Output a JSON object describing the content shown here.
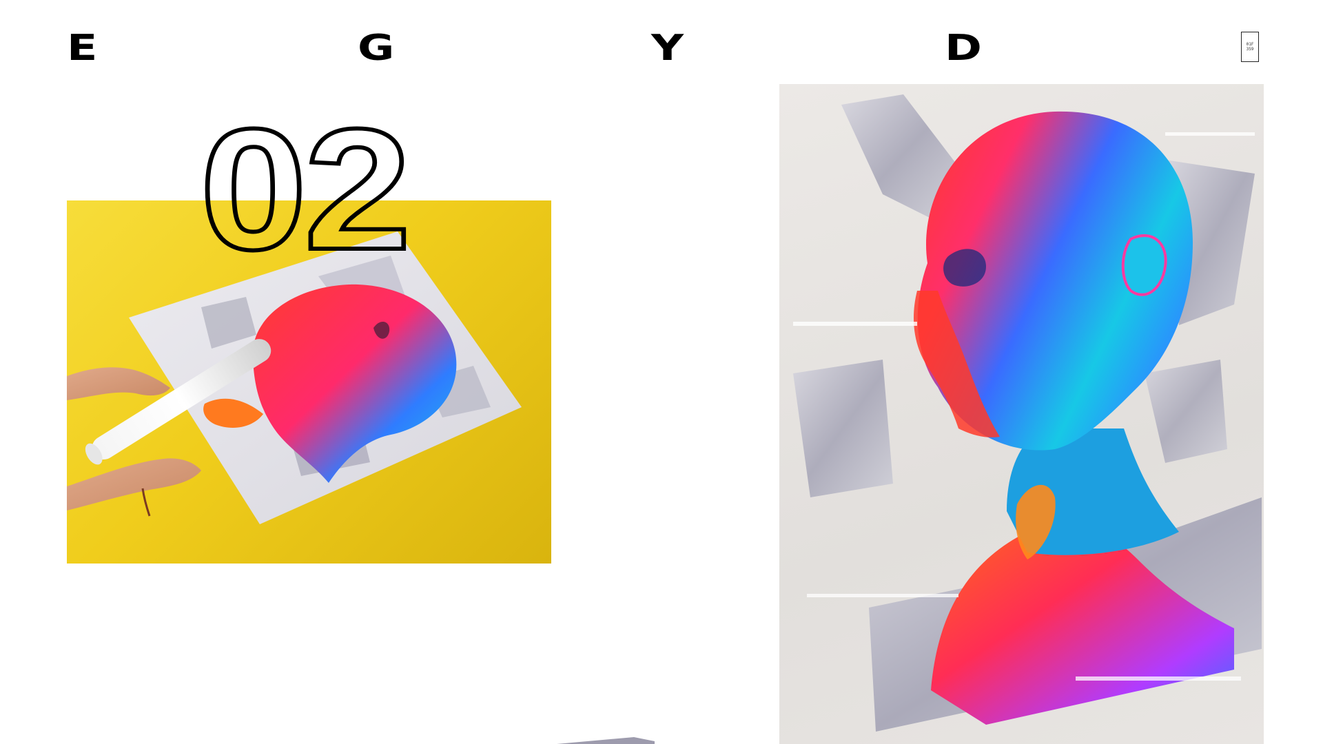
{
  "logo": {
    "letters": [
      "E",
      "G",
      "Y",
      "D"
    ]
  },
  "menu_badge": {
    "line1": "01F",
    "line2": "359"
  },
  "hero": {
    "number": "02"
  },
  "colors": {
    "background": "#ffffff",
    "text": "#000000",
    "photo_background": "#f0cd1c",
    "poster_background": "#e8e5e2"
  }
}
